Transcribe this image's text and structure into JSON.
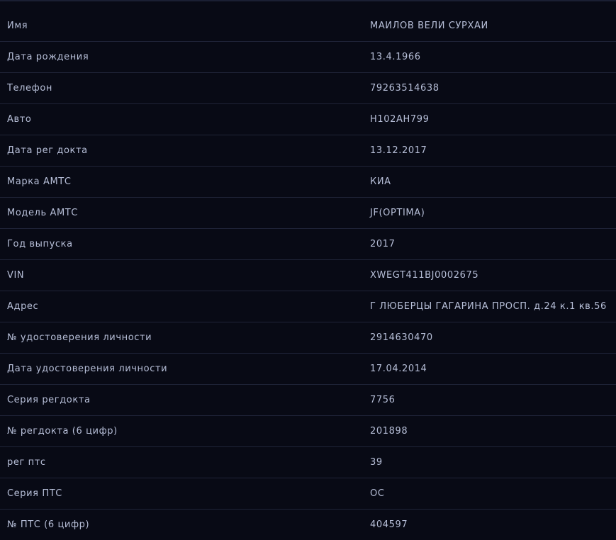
{
  "rows": [
    {
      "label": "Имя",
      "value": "МАИЛОВ ВЕЛИ СУРХАЙ"
    },
    {
      "label": "Дата рождения",
      "value": "13.4.1966"
    },
    {
      "label": "Телефон",
      "value": "79263514638"
    },
    {
      "label": "Авто",
      "value": "Н102АН799"
    },
    {
      "label": "Дата рег докта",
      "value": "13.12.2017"
    },
    {
      "label": "Марка АМТС",
      "value": "КИА"
    },
    {
      "label": "Модель АМТС",
      "value": "JF(OPTIMA)"
    },
    {
      "label": "Год выпуска",
      "value": "2017"
    },
    {
      "label": "VIN",
      "value": "XWEGT411BJ0002675"
    },
    {
      "label": "Адрес",
      "value": "Г ЛЮБЕРЦЫ ГАГАРИНА ПРОСП. д.24 к.1 кв.56"
    },
    {
      "label": "№ удостоверения личности",
      "value": "2914630470"
    },
    {
      "label": "Дата удостоверения личности",
      "value": "17.04.2014"
    },
    {
      "label": "Серия регдокта",
      "value": "7756"
    },
    {
      "label": "№ регдокта (6 цифр)",
      "value": "201898"
    },
    {
      "label": "рег птс",
      "value": "39"
    },
    {
      "label": "Серия ПТС",
      "value": "ОС"
    },
    {
      "label": "№ ПТС (6 цифр)",
      "value": "404597"
    }
  ]
}
